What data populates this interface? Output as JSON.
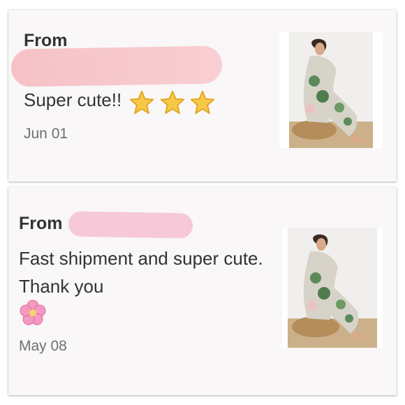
{
  "reviews": [
    {
      "from_label": "From",
      "text": "Super cute!!",
      "stars": 3,
      "date": "Jun 01",
      "product_image": "product-photo-model-in-floral-pajama-set"
    },
    {
      "from_label": "From",
      "text": "Fast shipment and super cute. Thank you",
      "emoji": "pink-flower",
      "date": "May 08",
      "product_image": "product-photo-model-in-floral-pajama-set"
    }
  ],
  "colors": {
    "card_background": "#f9f7f8",
    "text": "#333333",
    "date_text": "#6f6f6f",
    "redaction_pink": "#f6c9cd",
    "star_gold": "#f7c948"
  }
}
